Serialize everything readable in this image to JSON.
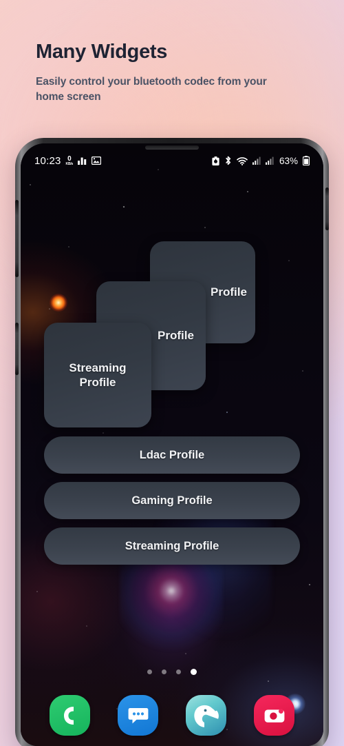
{
  "header": {
    "title": "Many Widgets",
    "subtitle": "Easily control your bluetooth codec from your home screen"
  },
  "colors": {
    "title": "#1e2333",
    "subtitle": "#4a5265",
    "card_bg": "#343b46",
    "pill_bg": "#3b424d",
    "accent_white": "#ffffff",
    "bg_gradient_start": "#f7d2cb",
    "bg_gradient_end": "#ded4f3"
  },
  "phone": {
    "statusbar": {
      "clock": "10:23",
      "netspeed_value": "0",
      "netspeed_unit": "KB/s",
      "left_icons": [
        "network-speed-icon",
        "signal-graph-icon",
        "image-icon"
      ],
      "right_icons": [
        "battery-saver-icon",
        "bluetooth-icon",
        "wifi-icon",
        "sim1-signal-icon",
        "sim2-signal-icon"
      ],
      "battery_percent": "63%"
    },
    "widget_cards": [
      {
        "label": "Ldac Profile",
        "visible_text": "Profile"
      },
      {
        "label": "Gaming Profile",
        "visible_text": "Profile"
      },
      {
        "label": "Streaming Profile",
        "visible_text": "Streaming\nProfile"
      }
    ],
    "pill_buttons": [
      {
        "label": "Ldac Profile"
      },
      {
        "label": "Gaming Profile"
      },
      {
        "label": "Streaming Profile"
      }
    ],
    "page_dots": {
      "count": 4,
      "active_index": 3
    },
    "dock": [
      {
        "name": "phone",
        "label": "Phone"
      },
      {
        "name": "messages",
        "label": "Messages"
      },
      {
        "name": "kiwi-browser",
        "label": "Kiwi Browser"
      },
      {
        "name": "camera",
        "label": "Camera"
      }
    ]
  }
}
